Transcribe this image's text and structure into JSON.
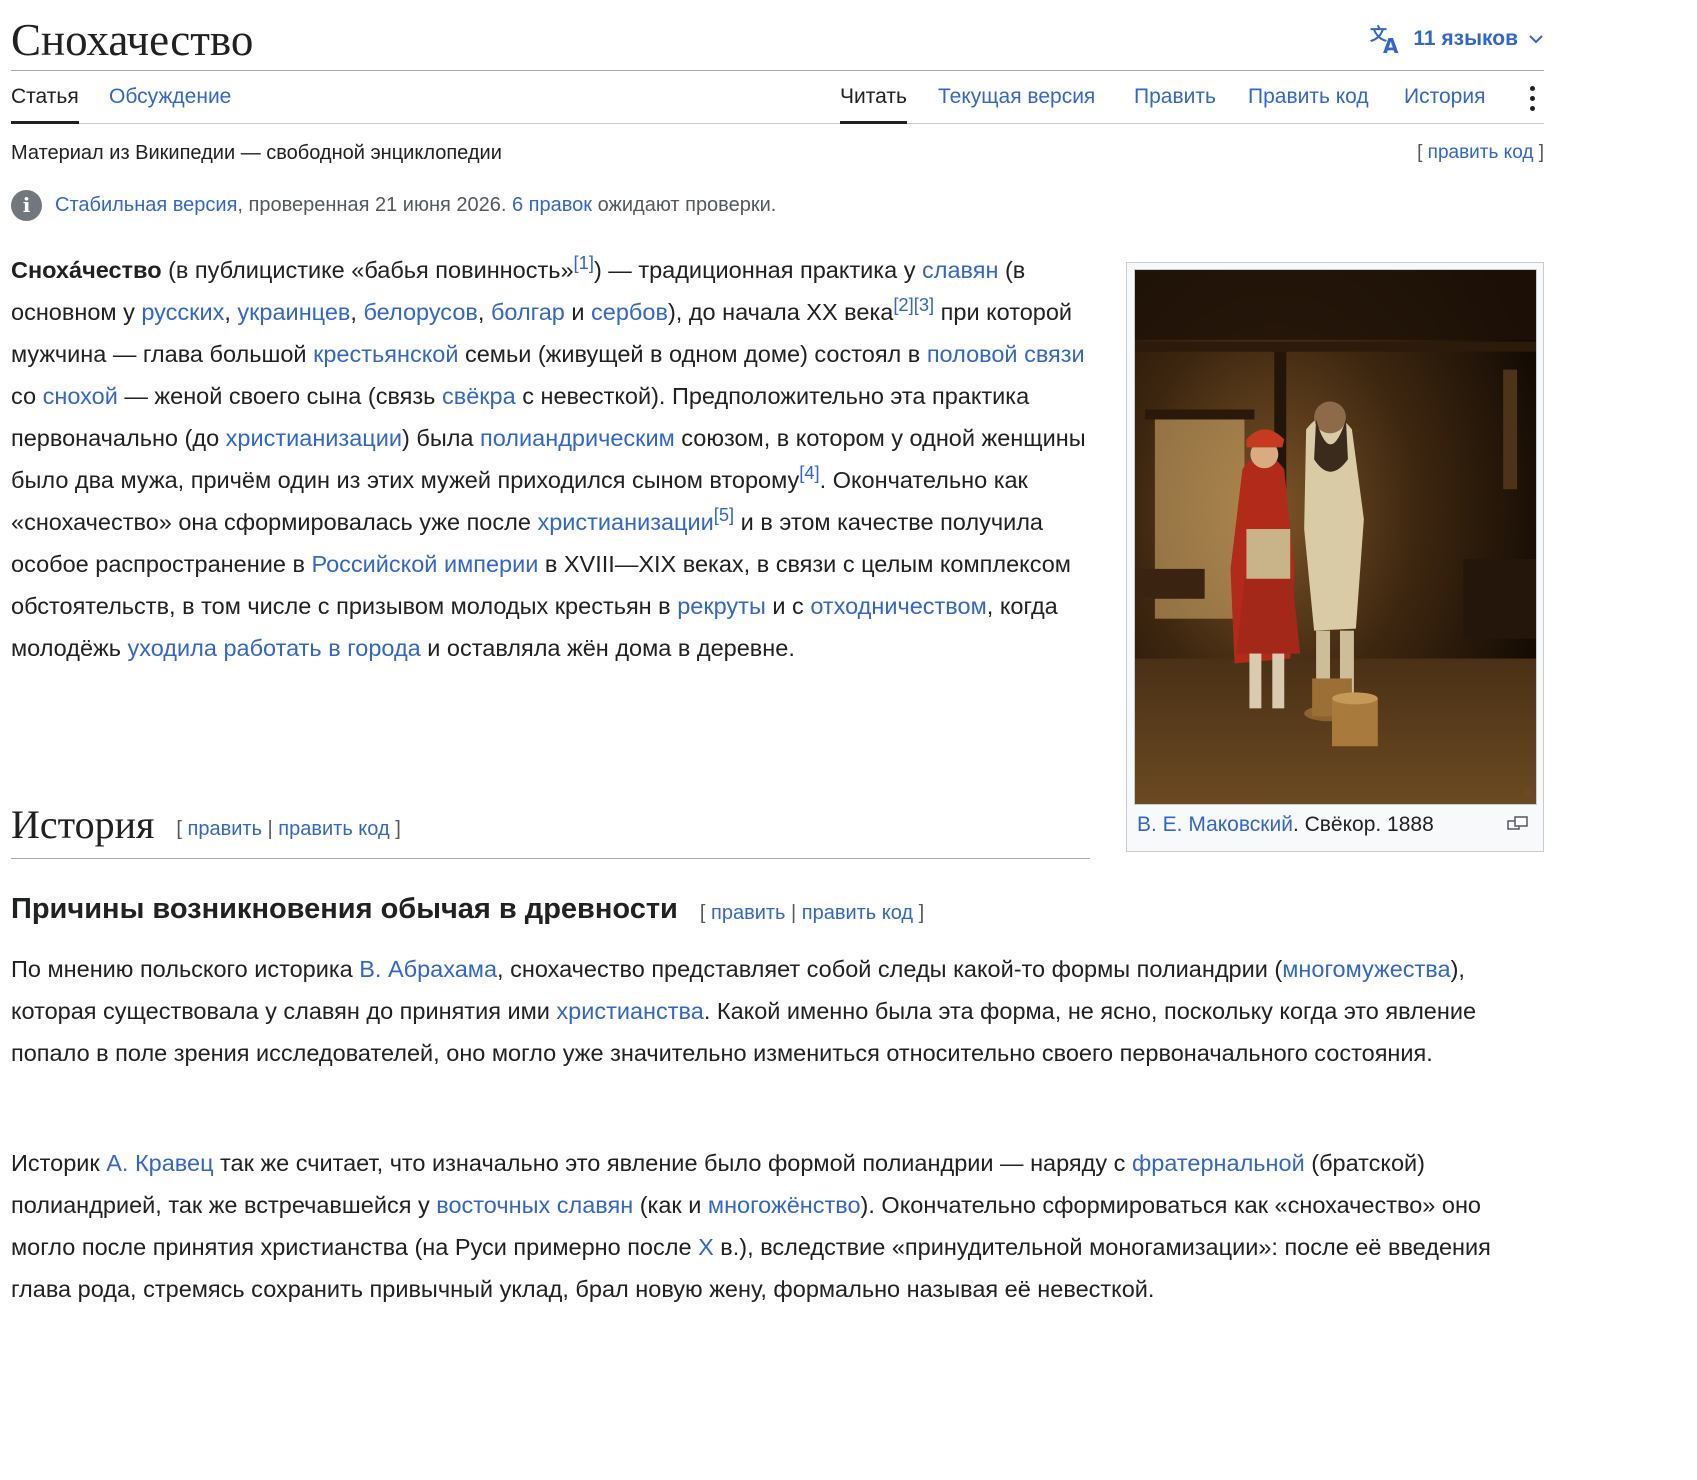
{
  "page": {
    "title": "Снохачество",
    "languages_label": "11 языков"
  },
  "tabs": {
    "article": "Статья",
    "talk": "Обсуждение",
    "read": "Читать",
    "current_version": "Текущая версия",
    "edit": "Править",
    "edit_source": "Править код",
    "history": "История"
  },
  "tagline": "Материал из Википедии — свободной энциклопедии",
  "top_edit": {
    "open": "[",
    "label": "править код",
    "close": "]"
  },
  "notice": {
    "stable_link": "Стабильная версия",
    "checked": ", проверенная 21 июня 2026. ",
    "pending_link": "6 правок",
    "pending_tail": " ожидают проверки."
  },
  "lead": {
    "t1_bold": "Снохá́чество",
    "t2": " (в публицистике «бабья повинность»",
    "ref1": "[1]",
    "t3": ") — традиционная практика у ",
    "l_slavs": "славян",
    "t4": " (в основном у ",
    "l_russians": "русских",
    "t5": ", ",
    "l_ukrainians": "украинцев",
    "t6": ", ",
    "l_belarusians": "белорусов",
    "t7": ", ",
    "l_bulgarians": "болгар",
    "t8": " и ",
    "l_serbs": "сербов",
    "t9": "), до начала XX века",
    "ref2": "[2]",
    "ref3": "[3]",
    "t10": " при которой мужчина — глава большой ",
    "l_peasant": "крестьянской",
    "t11": " семьи (живущей в одном доме) состоял в ",
    "l_sexual": "половой связи",
    "t12": " со ",
    "l_snokha": "снохой",
    "t13": " — женой своего сына (связь ",
    "l_svekor": "свёкра",
    "t14": " с невесткой). Предположительно эта практика первоначально (до ",
    "l_christianization1": "христианизации",
    "t15": ") была ",
    "l_polyandric": "полиандрическим",
    "t16": " союзом, в котором у одной женщины было два мужа, причём один из этих мужей приходился сыном второму",
    "ref4": "[4]",
    "t17": ". Окончательно как «снохачество» она сформировалась уже после ",
    "l_christianization2": "христианизации",
    "ref5": "[5]",
    "t18": " и в этом качестве получила особое распространение в ",
    "l_empire": "Российской империи",
    "t19": " в XVIII—XIX веках, в связи с целым комплексом обстоятельств, в том числе с призывом молодых крестьян в ",
    "l_recruits": "рекруты",
    "t20": " и с ",
    "l_otkhod": "отходничеством",
    "t21": ", когда молодёжь ",
    "l_towns": "уходила работать в города",
    "t22": " и оставляла жён дома в деревне."
  },
  "figure": {
    "author_link": "В. Е. Маковский",
    "caption_rest": ". Свёкор. 1888"
  },
  "section_history": {
    "heading": "История",
    "open": "[ ",
    "edit": "править",
    "sep": " | ",
    "edit_source": "править код",
    "close": " ]"
  },
  "section_causes": {
    "heading": "Причины возникновения обычая в древности",
    "open": "[ ",
    "edit": "править",
    "sep": " | ",
    "edit_source": "править код",
    "close": " ]"
  },
  "para2": {
    "t1": "По мнению польского историка ",
    "l_abraham": "В. Абрахама",
    "t2": ", снохачество представляет собой следы какой-то формы полиандрии (",
    "l_polyandry": "многомужества",
    "t3": "), которая существовала у славян до принятия ими ",
    "l_christianity": "христианства",
    "t4": ". Какой именно была эта форма, не ясно, поскольку когда это явление попало в поле зрения исследователей, оно могло уже значительно измениться относительно своего первоначального состояния."
  },
  "para3": {
    "t1": "Историк ",
    "l_kravets": "А. Кравец",
    "t2": " так же считает, что изначально это явление было формой полиандрии — наряду с ",
    "l_fraternal": "фратернальной",
    "t3": " (братской) полиандрией, так же встречавшейся у ",
    "l_east_slavs": "восточных славян",
    "t4": " (как и ",
    "l_polygyny": "многожёнство",
    "t5": "). Окончательно сформироваться как «снохачество» оно могло после принятия христианства (на Руси примерно после ",
    "l_xcentury": "X",
    "t6": " в.), вследствие «принудительной моногамизации»: после её введения глава рода, стремясь сохранить привычный уклад, брал новую жену, формально называя её невесткой."
  },
  "colors": {
    "link": "#3366cc",
    "text": "#202122",
    "muted": "#54595d",
    "border": "#a2a9b1"
  },
  "icons": {
    "language": "translate-icon",
    "chevron": "chevron-down-icon",
    "more": "ellipsis-vertical-icon",
    "info": "info-icon",
    "magnify": "magnify-clip-icon"
  }
}
